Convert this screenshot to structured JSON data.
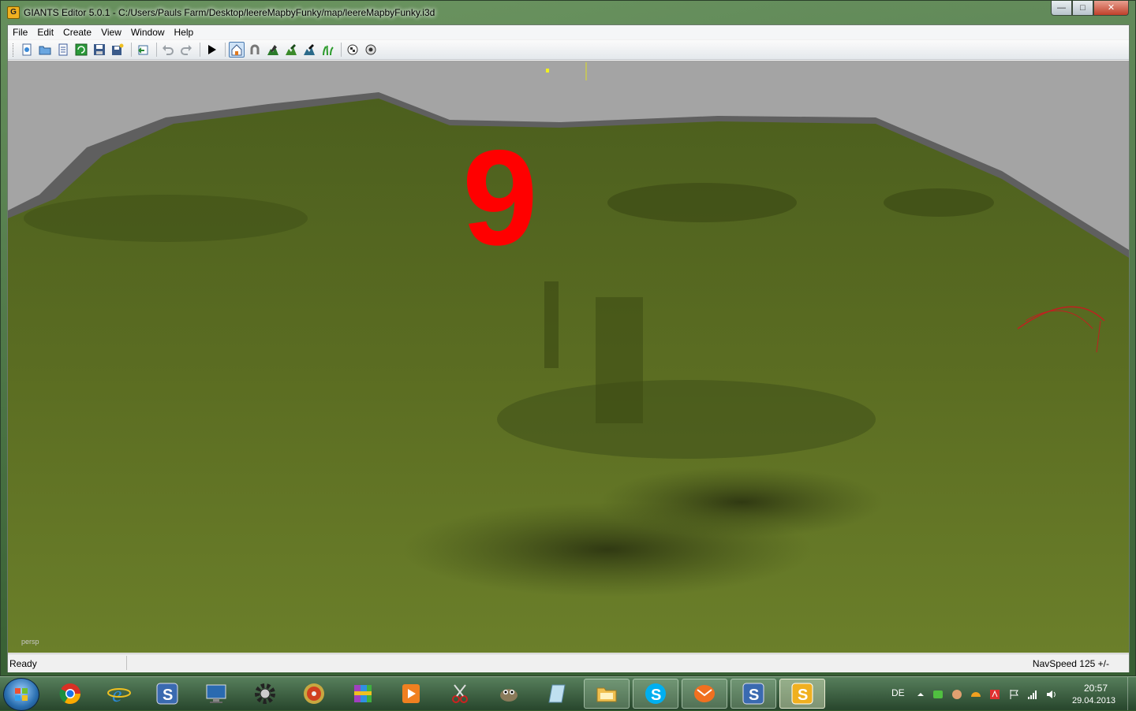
{
  "window": {
    "app_icon_glyph": "G",
    "title": "GIANTS Editor 5.0.1 - C:/Users/Pauls Farm/Desktop/leereMapbyFunky/map/leereMapbyFunky.i3d",
    "controls": {
      "minimize": "—",
      "maximize": "□",
      "close": "✕"
    }
  },
  "menu": [
    "File",
    "Edit",
    "Create",
    "View",
    "Window",
    "Help"
  ],
  "toolbar": {
    "buttons": [
      "new-file-icon",
      "open-file-icon",
      "document-icon",
      "refresh-icon",
      "save-icon",
      "save-all-icon",
      "import-icon",
      "undo-icon",
      "redo-icon",
      "play-icon",
      "home-camera-icon",
      "magnet-icon",
      "terrain-sculpt-icon",
      "terrain-paint-icon",
      "foliage-paint-icon",
      "grass-paint-icon",
      "checker-icon",
      "settings-checker-icon"
    ],
    "active_button": "home-camera-icon"
  },
  "viewport": {
    "camera_label": "persp",
    "overlay_number": "9"
  },
  "status": {
    "left": "Ready",
    "right": "NavSpeed 125 +/-"
  },
  "taskbar": {
    "apps": [
      {
        "name": "chrome-icon",
        "state": "pinned"
      },
      {
        "name": "internet-explorer-icon",
        "state": "pinned"
      },
      {
        "name": "giants-app-icon",
        "state": "pinned"
      },
      {
        "name": "computer-icon",
        "state": "pinned"
      },
      {
        "name": "gear-icon",
        "state": "pinned"
      },
      {
        "name": "disc-icon",
        "state": "pinned"
      },
      {
        "name": "archive-icon",
        "state": "pinned"
      },
      {
        "name": "media-player-icon",
        "state": "pinned"
      },
      {
        "name": "snipping-icon",
        "state": "pinned"
      },
      {
        "name": "gimp-icon",
        "state": "pinned"
      },
      {
        "name": "notepad-icon",
        "state": "pinned"
      },
      {
        "name": "explorer-folder-icon",
        "state": "open"
      },
      {
        "name": "skype-icon",
        "state": "open"
      },
      {
        "name": "mail-icon",
        "state": "open"
      },
      {
        "name": "giants-app-icon",
        "state": "open"
      },
      {
        "name": "giants-editor-icon",
        "state": "active"
      }
    ],
    "language": "DE",
    "tray_icons": [
      "chevron-up-icon",
      "shield-icon",
      "hand-icon",
      "helmet-icon",
      "antivirus-icon",
      "flag-icon",
      "network-icon",
      "volume-icon"
    ],
    "clock_time": "20:57",
    "clock_date": "29.04.2013"
  }
}
